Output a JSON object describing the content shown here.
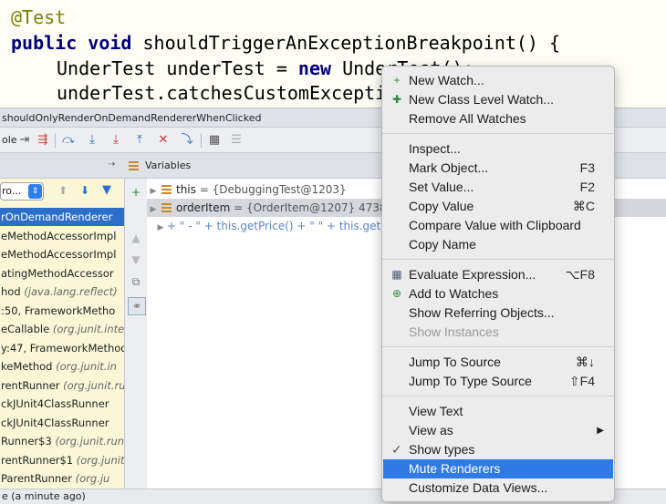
{
  "editor": {
    "annotation": "@Test",
    "line2_kw": "public void ",
    "line2_rest": "shouldTriggerAnExceptionBreakpoint() {",
    "line3_pre": "UnderTest underTest = ",
    "line3_kw": "new",
    "line3_post": " UnderTest();",
    "line4": "underTest.catchesCustomException();"
  },
  "debug": {
    "title": "shouldOnlyRenderOnDemandRendererWhenClicked",
    "toolbar_text": "ole",
    "variables_label": "Variables",
    "thread_value": "ro...",
    "frames": [
      {
        "text": "rOnDemandRenderer",
        "loc": ""
      },
      {
        "text": "eMethodAccessorImpl",
        "loc": ""
      },
      {
        "text": "eMethodAccessorImpl",
        "loc": ""
      },
      {
        "text": "atingMethodAccessor",
        "loc": ""
      },
      {
        "text": "hod ",
        "loc": "(java.lang.reflect)"
      },
      {
        "text": ":50, FrameworkMetho",
        "loc": ""
      },
      {
        "text": "eCallable ",
        "loc": "(org.junit.inte"
      },
      {
        "text": "y:47, FrameworkMethod",
        "loc": ""
      },
      {
        "text": "keMethod ",
        "loc": "(org.junit.in"
      },
      {
        "text": "rentRunner ",
        "loc": "(org.junit.ru"
      },
      {
        "text": "ckJUnit4ClassRunner",
        "loc": ""
      },
      {
        "text": "ckJUnit4ClassRunner",
        "loc": ""
      },
      {
        "text": "Runner$3 ",
        "loc": "(org.junit.run"
      },
      {
        "text": "rentRunner$1 ",
        "loc": "(org.junit"
      },
      {
        "text": " ParentRunner ",
        "loc": "(org.ju"
      }
    ],
    "variables": [
      {
        "name": "this",
        "value": " = {DebuggingTest@1203}"
      },
      {
        "name": "orderItem",
        "value": " = {OrderItem@1207} 4738"
      },
      {
        "renderer": "+ \" - \" + this.getPrice() + \" \" + this.getO"
      }
    ],
    "status": "e (a minute ago)"
  },
  "menu": {
    "items": [
      {
        "label": "New Watch...",
        "shortcut": "",
        "icon": "plus-watch-icon"
      },
      {
        "label": "New Class Level Watch...",
        "shortcut": "",
        "icon": "class-watch-icon"
      },
      {
        "label": "Remove All Watches",
        "shortcut": ""
      },
      {
        "label": "Inspect...",
        "shortcut": ""
      },
      {
        "label": "Mark Object...",
        "shortcut": "F3"
      },
      {
        "label": "Set Value...",
        "shortcut": "F2"
      },
      {
        "label": "Copy Value",
        "shortcut": "⌘C"
      },
      {
        "label": "Compare Value with Clipboard",
        "shortcut": ""
      },
      {
        "label": "Copy Name",
        "shortcut": ""
      },
      {
        "label": "Evaluate Expression...",
        "shortcut": "⌥F8",
        "icon": "calculator-icon"
      },
      {
        "label": "Add to Watches",
        "shortcut": "",
        "icon": "add-watch-icon"
      },
      {
        "label": "Show Referring Objects...",
        "shortcut": ""
      },
      {
        "label": "Show Instances",
        "shortcut": ""
      },
      {
        "label": "Jump To Source",
        "shortcut": "⌘↓"
      },
      {
        "label": "Jump To Type Source",
        "shortcut": "⇧F4"
      },
      {
        "label": "View Text",
        "shortcut": ""
      },
      {
        "label": "View as",
        "shortcut": ""
      },
      {
        "label": "Show types",
        "shortcut": ""
      },
      {
        "label": "Mute Renderers",
        "shortcut": ""
      },
      {
        "label": "Customize Data Views...",
        "shortcut": ""
      }
    ]
  },
  "colors": {
    "selection": "#2d6ec9",
    "menu_highlight": "#2f7ae5",
    "frames_bg": "#fbf7d6"
  }
}
